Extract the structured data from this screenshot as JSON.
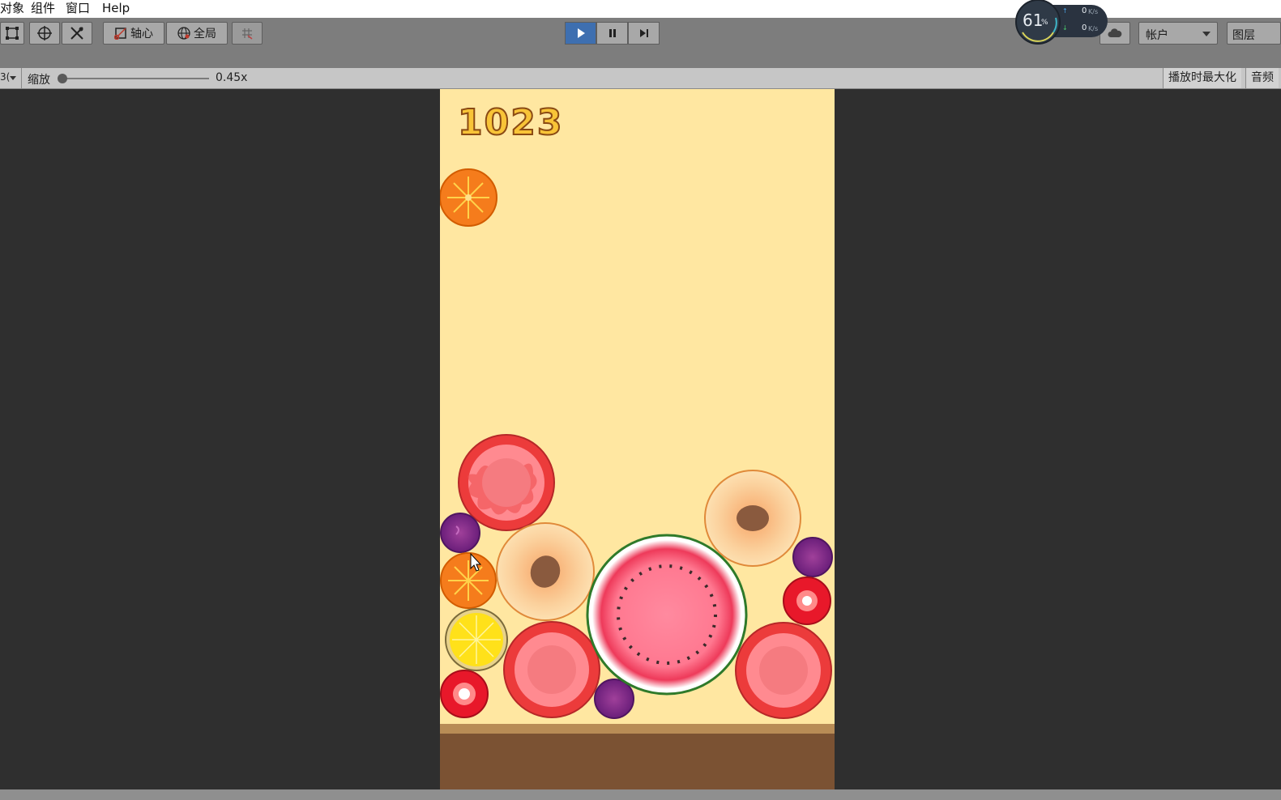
{
  "menubar": {
    "items": [
      "对象",
      "组件",
      "窗口",
      "Help"
    ]
  },
  "toolbar": {
    "pivot_label": "轴心",
    "global_label": "全局",
    "account_label": "帐户",
    "layers_label": "图层"
  },
  "net_widget": {
    "cpu_percent": "61",
    "cpu_unit": "%",
    "upload_value": "0",
    "upload_unit": "K/s",
    "download_value": "0",
    "download_unit": "K/s"
  },
  "gamebar": {
    "aspect_label": "3(",
    "scale_label": "缩放",
    "scale_value": "0.45x",
    "maximize_label": "播放时最大化",
    "audio_label": "音频"
  },
  "game": {
    "score": "1023",
    "fruit_names": [
      "orange",
      "tomato",
      "grape",
      "peach",
      "lemon",
      "strawberry",
      "watermelon"
    ]
  },
  "colors": {
    "play_active": "#3e6fb0",
    "game_bg": "#ffe7a1",
    "ground": "#7b5233"
  }
}
